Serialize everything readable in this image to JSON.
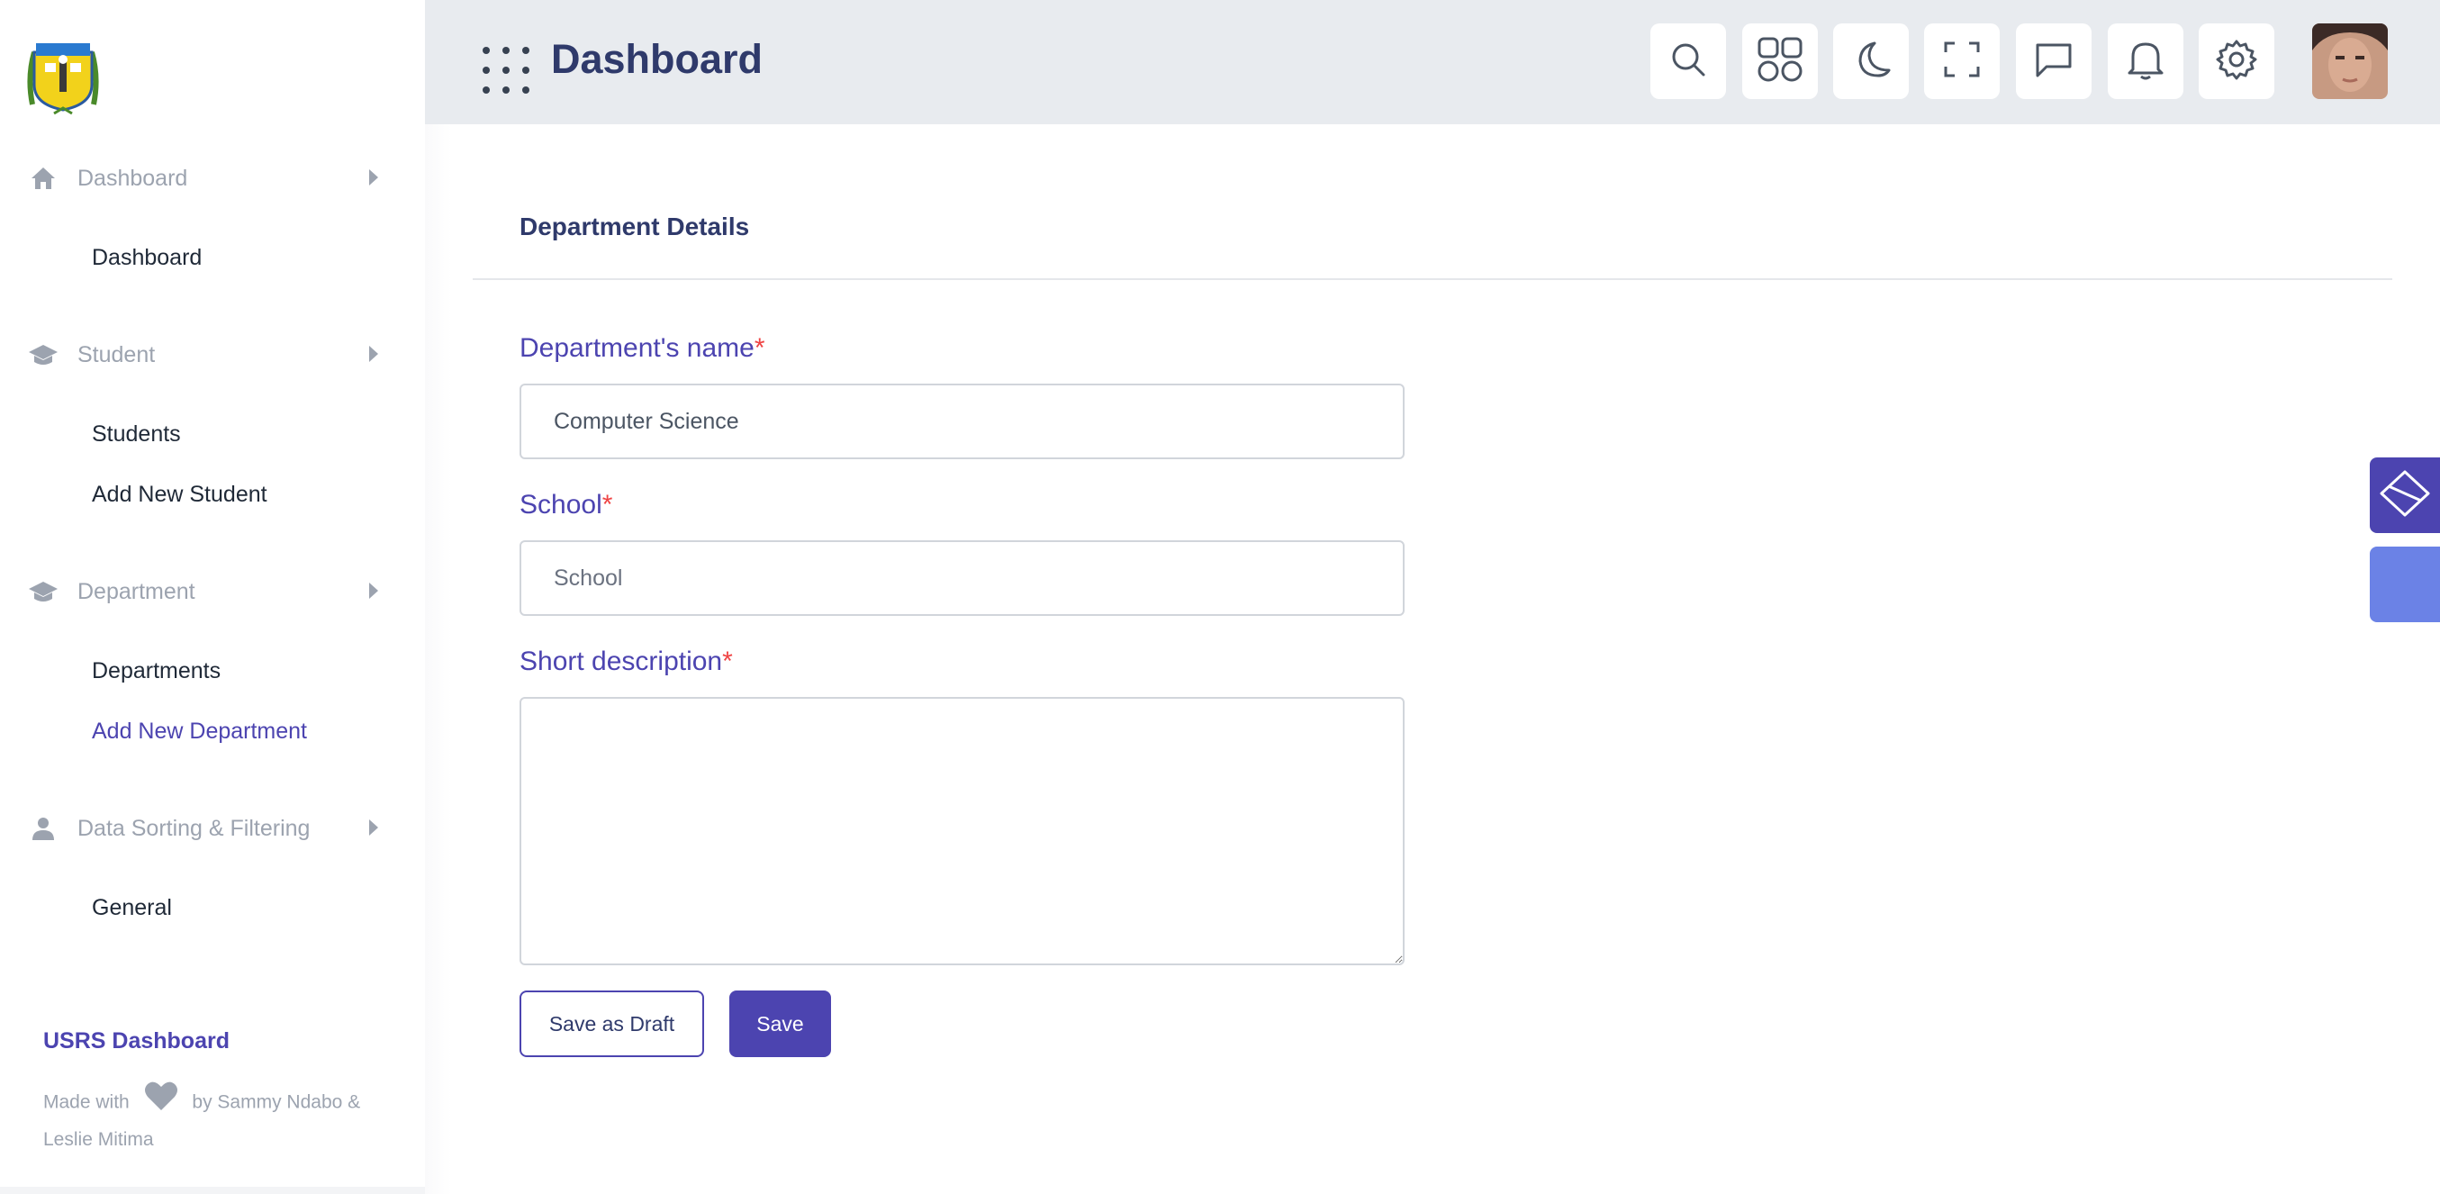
{
  "header": {
    "title": "Dashboard",
    "tools": [
      "search-icon",
      "apps-icon",
      "moon-icon",
      "fullscreen-icon",
      "chat-icon",
      "bell-icon",
      "gear-icon"
    ]
  },
  "sidebar": {
    "sections": [
      {
        "label": "Dashboard",
        "icon": "home-icon",
        "items": [
          {
            "label": "Dashboard",
            "active": false
          }
        ]
      },
      {
        "label": "Student",
        "icon": "graduation-cap-icon",
        "items": [
          {
            "label": "Students",
            "active": false
          },
          {
            "label": "Add New Student",
            "active": false
          }
        ]
      },
      {
        "label": "Department",
        "icon": "graduation-cap-icon",
        "items": [
          {
            "label": "Departments",
            "active": false
          },
          {
            "label": "Add New Department",
            "active": true
          }
        ]
      },
      {
        "label": "Data Sorting & Filtering",
        "icon": "person-icon",
        "items": [
          {
            "label": "General",
            "active": false
          }
        ]
      }
    ],
    "brand": "USRS Dashboard",
    "credits": {
      "made_with": "Made with",
      "by": "by Sammy Ndabo & Leslie Mitima"
    }
  },
  "form": {
    "title": "Department Details",
    "required_mark": "*",
    "name_label": "Department's name",
    "name_value": "Computer Science",
    "school_label": "School",
    "school_placeholder": "School",
    "description_label": "Short description",
    "description_value": "",
    "draft_button": "Save as Draft",
    "save_button": "Save"
  },
  "colors": {
    "accent": "#4c44b0",
    "title": "#2f3a6b",
    "required": "#ef4444",
    "topbar_bg": "#e8ebef",
    "float_secondary": "#6b82e6"
  }
}
